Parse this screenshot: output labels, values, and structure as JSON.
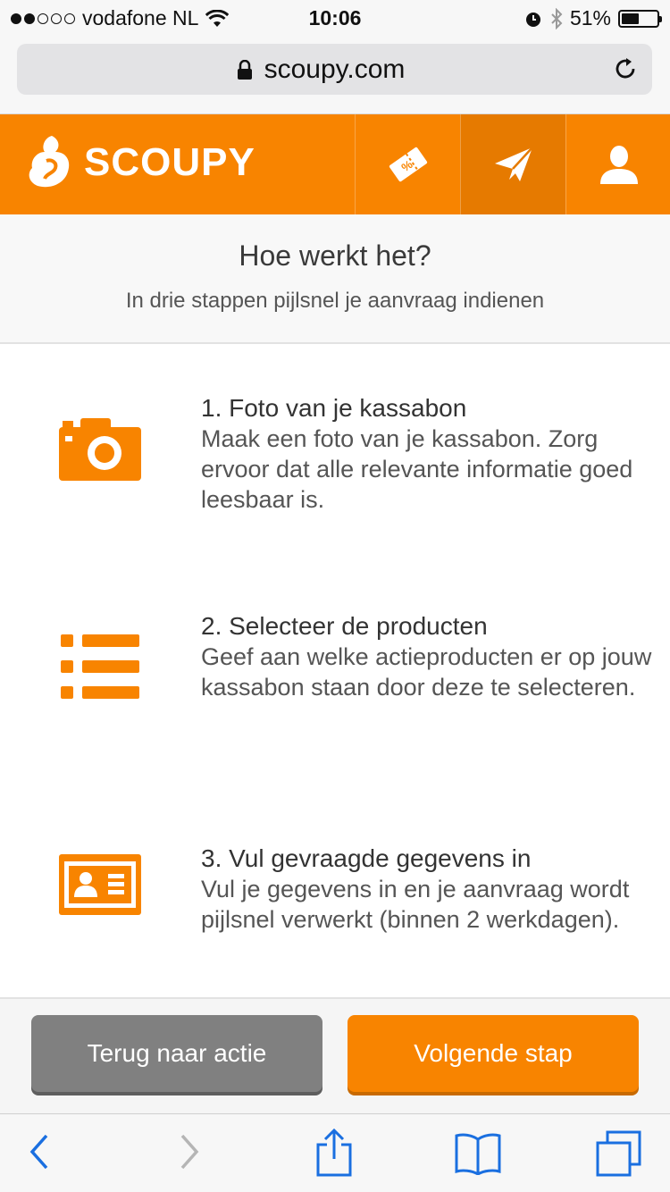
{
  "status_bar": {
    "carrier": "vodafone NL",
    "time": "10:06",
    "battery": "51%",
    "battery_level": 0.51
  },
  "browser": {
    "url": "scoupy.com"
  },
  "header": {
    "logo_text": "SCOUPY",
    "nav_icons": [
      "coupon-icon",
      "paper-plane-icon",
      "user-icon"
    ],
    "active_index": 1
  },
  "intro": {
    "title": "Hoe werkt het?",
    "subtitle": "In drie stappen pijlsnel je aanvraag indienen"
  },
  "steps": [
    {
      "icon": "camera-icon",
      "title": "1. Foto van je kassabon",
      "body": "Maak een foto van je kassabon. Zorg ervoor dat alle relevante informatie goed leesbaar is."
    },
    {
      "icon": "list-icon",
      "title": "2. Selecteer de producten",
      "body": "Geef aan welke actieproducten er op jouw kassabon staan door deze te selecteren."
    },
    {
      "icon": "id-card-icon",
      "title": "3. Vul gevraagde gegevens in",
      "body": "Vul je gegevens in en je aanvraag wordt pijlsnel verwerkt (binnen 2 werkdagen)."
    }
  ],
  "actions": {
    "back_label": "Terug naar actie",
    "next_label": "Volgende stap"
  },
  "colors": {
    "brand_orange": "#f88400",
    "button_grey": "#808080",
    "ios_blue": "#1a6fe0"
  }
}
